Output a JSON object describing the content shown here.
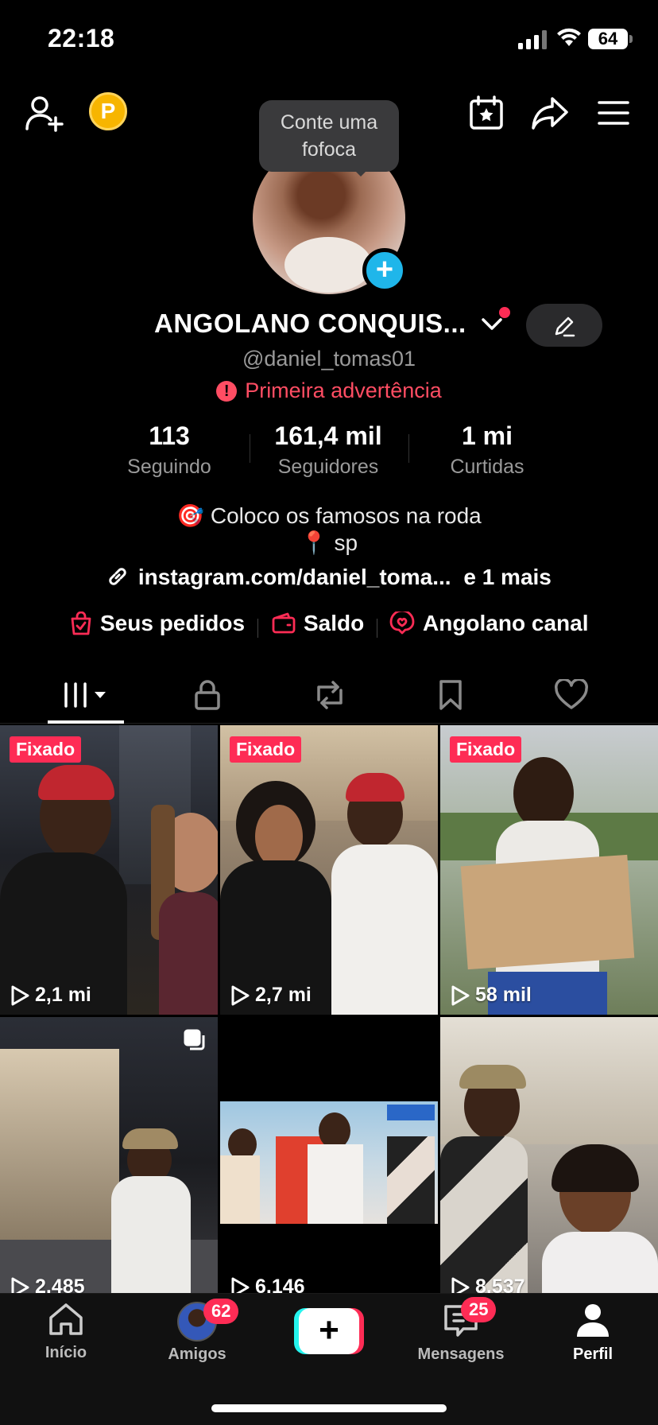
{
  "status_bar": {
    "time": "22:18",
    "battery": "64"
  },
  "tooltip": {
    "line1": "Conte uma",
    "line2": "fofoca"
  },
  "coin_label": "P",
  "profile": {
    "name": "ANGOLANO CONQUIS...",
    "handle": "@daniel_tomas01",
    "warning": "Primeira advertência"
  },
  "stats": [
    {
      "value": "113",
      "label": "Seguindo"
    },
    {
      "value": "161,4 mil",
      "label": "Seguidores"
    },
    {
      "value": "1 mi",
      "label": "Curtidas"
    }
  ],
  "bio": {
    "line1": "🎯 Coloco os famosos na roda",
    "line2": "📍 sp"
  },
  "link": {
    "url": "instagram.com/daniel_toma...",
    "more": "e 1 mais"
  },
  "shortcuts": [
    {
      "label": "Seus pedidos",
      "icon": "shopping-bag-icon"
    },
    {
      "label": "Saldo",
      "icon": "wallet-icon"
    },
    {
      "label": "Angolano canal",
      "icon": "heart-chat-icon"
    }
  ],
  "tabs": [
    "videos-grid-icon",
    "lock-icon",
    "repost-icon",
    "bookmark-icon",
    "heart-icon"
  ],
  "videos": [
    {
      "pinned": "Fixado",
      "views": "2,1 mi"
    },
    {
      "pinned": "Fixado",
      "views": "2,7 mi"
    },
    {
      "pinned": "Fixado",
      "views": "58 mil"
    },
    {
      "pinned": "",
      "views": "2.485"
    },
    {
      "pinned": "",
      "views": "6.146"
    },
    {
      "pinned": "",
      "views": "8.537"
    }
  ],
  "nav": {
    "home": "Início",
    "friends": "Amigos",
    "friends_badge": "62",
    "messages": "Mensagens",
    "messages_badge": "25",
    "profile": "Perfil",
    "create": "+"
  },
  "colors": {
    "accent": "#fe2c55",
    "cyan": "#25f4ee",
    "warning": "#ff4d63",
    "add_blue": "#1fb6ea"
  }
}
